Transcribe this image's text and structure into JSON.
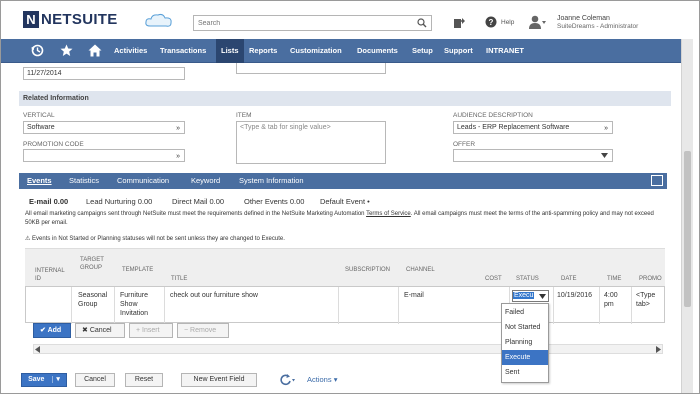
{
  "app": {
    "logo_letter": "N",
    "logo_text": "NETSUITE"
  },
  "search": {
    "placeholder": "Search"
  },
  "header": {
    "help_label": "Help",
    "user_name": "Joanne Coleman",
    "user_role": "SuiteDreams - Administrator"
  },
  "nav": {
    "items": [
      "Activities",
      "Transactions",
      "Lists",
      "Reports",
      "Customization",
      "Documents",
      "Setup",
      "Support",
      "INTRANET"
    ],
    "active": "Lists"
  },
  "form": {
    "date_value": "11/27/2014",
    "section_title": "Related Information",
    "vertical_label": "VERTICAL",
    "vertical_value": "Software",
    "item_label": "ITEM",
    "item_placeholder": "<Type & tab for single value>",
    "audience_label": "AUDIENCE DESCRIPTION",
    "audience_value": "Leads - ERP Replacement Software",
    "promo_label": "PROMOTION CODE",
    "offer_label": "OFFER"
  },
  "tabs": [
    "Events",
    "Statistics",
    "Communication",
    "Keyword",
    "System Information"
  ],
  "subtabs": [
    "E-mail 0.00",
    "Lead Nurturing 0.00",
    "Direct Mail 0.00",
    "Other Events 0.00",
    "Default Event •"
  ],
  "notice": {
    "text_before": "All email marketing campaigns sent through NetSuite must meet the requirements defined in the NetSuite Marketing Automation ",
    "link": "Terms of Service",
    "text_after": ". All email campaigns must meet the terms of the anti-spamming policy and may not exceed 50KB per email.",
    "execute_note": "Events in Not Started or Planning statuses will not be sent unless they are changed to Execute."
  },
  "grid": {
    "headers": {
      "internal_id": "INTERNAL ID",
      "target_group": "TARGET GROUP",
      "template": "TEMPLATE",
      "title": "TITLE",
      "subscription": "SUBSCRIPTION",
      "channel": "CHANNEL",
      "cost": "COST",
      "status": "STATUS",
      "date": "DATE",
      "time": "TIME",
      "promo": "PROMO"
    },
    "row": {
      "target_group": "Seasonal Group",
      "template": "Furniture Show Invitation",
      "title": "check out our furniture show",
      "channel": "E-mail",
      "status": "Execu",
      "date": "10/19/2016",
      "time": "4:00 pm",
      "promo": "<Type tab>"
    },
    "buttons": {
      "add": "Add",
      "cancel": "Cancel",
      "insert": "Insert",
      "remove": "Remove"
    }
  },
  "status_options": [
    "Failed",
    "Not Started",
    "Planning",
    "Execute",
    "Sent"
  ],
  "status_selected": "Execute",
  "bottom_buttons": {
    "save": "Save",
    "cancel": "Cancel",
    "reset": "Reset",
    "new_event_field": "New Event Field",
    "actions": "Actions"
  }
}
